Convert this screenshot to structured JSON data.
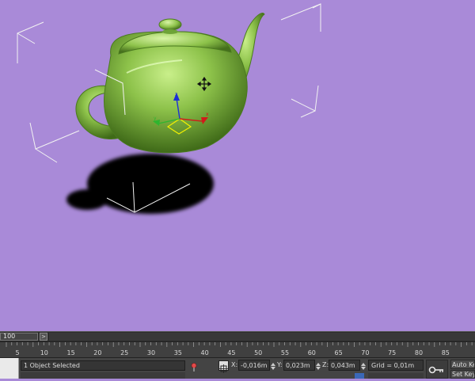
{
  "time_slider": {
    "label": "100",
    "arrow": ">"
  },
  "ruler": {
    "ticks": [
      "5",
      "10",
      "15",
      "20",
      "25",
      "30",
      "35",
      "40",
      "45",
      "50",
      "55",
      "60",
      "65",
      "70",
      "75",
      "80",
      "85"
    ]
  },
  "status": {
    "selection": "1 Object Selected",
    "x_label": "X:",
    "x_value": "-0,016m",
    "y_label": "Y:",
    "y_value": "0,023m",
    "z_label": "Z:",
    "z_value": "0,043m",
    "grid": "Grid = 0,01m",
    "auto_key": "Auto Key",
    "set_key": "Set Key"
  },
  "colors": {
    "viewport_bg": "#a98ad8",
    "teapot": "#8dc24a",
    "gizmo_x": "#d11a1a",
    "gizmo_y": "#2fb52f",
    "gizmo_z": "#1b2fd6",
    "gizmo_plane": "#f2f000"
  },
  "icons": {
    "pin": "pin-icon",
    "absolute_mode": "absolute-mode-icon",
    "key": "key-icon"
  }
}
